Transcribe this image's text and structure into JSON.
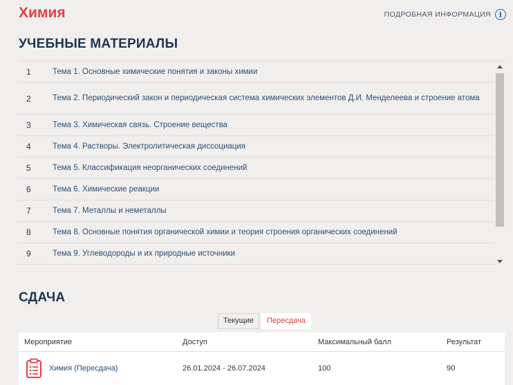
{
  "header": {
    "title": "Химия",
    "info_label": "ПОДРОБНАЯ ИНФОРМАЦИЯ",
    "info_icon": "info-icon"
  },
  "materials": {
    "heading": "УЧЕБНЫЕ МАТЕРИАЛЫ",
    "items": [
      {
        "num": "1",
        "label": "Тема 1. Основные химические понятия и законы химии"
      },
      {
        "num": "2",
        "label": "Тема 2. Периодический закон и периодическая система химических элементов Д.И. Менделеева и строение атома"
      },
      {
        "num": "3",
        "label": "Тема 3. Химическая связь. Строение вещества"
      },
      {
        "num": "4",
        "label": "Тема 4. Растворы. Электролитическая диссоциация"
      },
      {
        "num": "5",
        "label": "Тема 5. Классификация неорганических соединений"
      },
      {
        "num": "6",
        "label": "Тема 6. Химические реакции"
      },
      {
        "num": "7",
        "label": "Тема 7. Металлы и неметаллы"
      },
      {
        "num": "8",
        "label": "Тема 8. Основные понятия органической химии и теория строения органических соединений"
      },
      {
        "num": "9",
        "label": "Тема 9. Углеводороды и их природные источники"
      }
    ]
  },
  "submission": {
    "heading": "СДАЧА",
    "tabs": [
      {
        "label": "Текущие",
        "active": false
      },
      {
        "label": "Пересдача",
        "active": true
      }
    ],
    "columns": [
      "Мероприятие",
      "Доступ",
      "Максимальный балл",
      "Результат"
    ],
    "rows": [
      {
        "event": "Химия (Пересдача)",
        "access": "26.01.2024 - 26.07.2024",
        "max_score": "100",
        "result": "90",
        "icon": "clipboard-icon"
      }
    ]
  },
  "colors": {
    "accent": "#e33d4a",
    "link": "#2c4f72",
    "heading": "#1f3550",
    "background": "#f1efee"
  }
}
